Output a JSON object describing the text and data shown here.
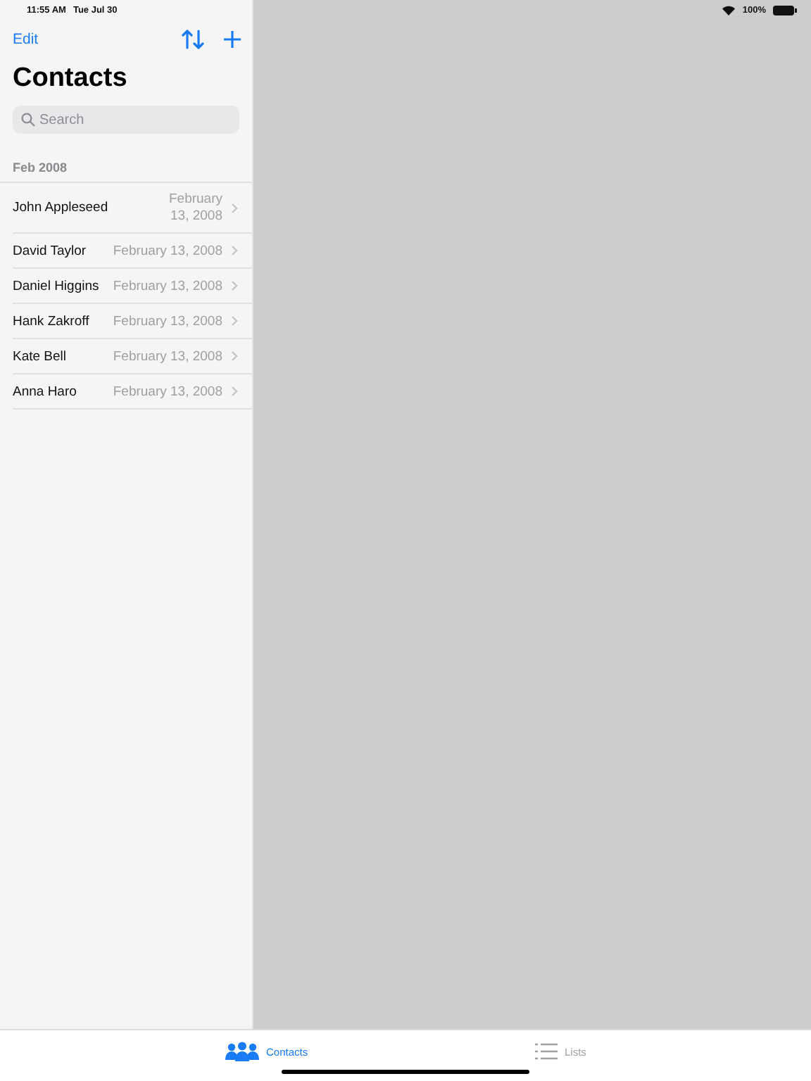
{
  "status_bar": {
    "time": "11:55 AM",
    "date": "Tue Jul 30",
    "battery": "100%"
  },
  "sidebar": {
    "edit": "Edit",
    "title": "Contacts",
    "search": {
      "placeholder": "Search"
    },
    "section": "Feb 2008",
    "rows": [
      {
        "name": "John Appleseed",
        "date": "February 13, 2008",
        "kind": "two-line"
      },
      {
        "name": "David Taylor",
        "date": "February 13, 2008",
        "kind": "single"
      },
      {
        "name": "Daniel Higgins",
        "date": "February 13, 2008",
        "kind": "single"
      },
      {
        "name": "Hank Zakroff",
        "date": "February 13, 2008",
        "kind": "single"
      },
      {
        "name": "Kate Bell",
        "date": "February 13, 2008",
        "kind": "single"
      },
      {
        "name": "Anna Haro",
        "date": "February 13, 2008",
        "kind": "single"
      }
    ]
  },
  "tabs": [
    {
      "label": "Contacts",
      "kind": "people",
      "selected": true
    },
    {
      "label": "Lists",
      "kind": "list",
      "selected": false
    }
  ]
}
